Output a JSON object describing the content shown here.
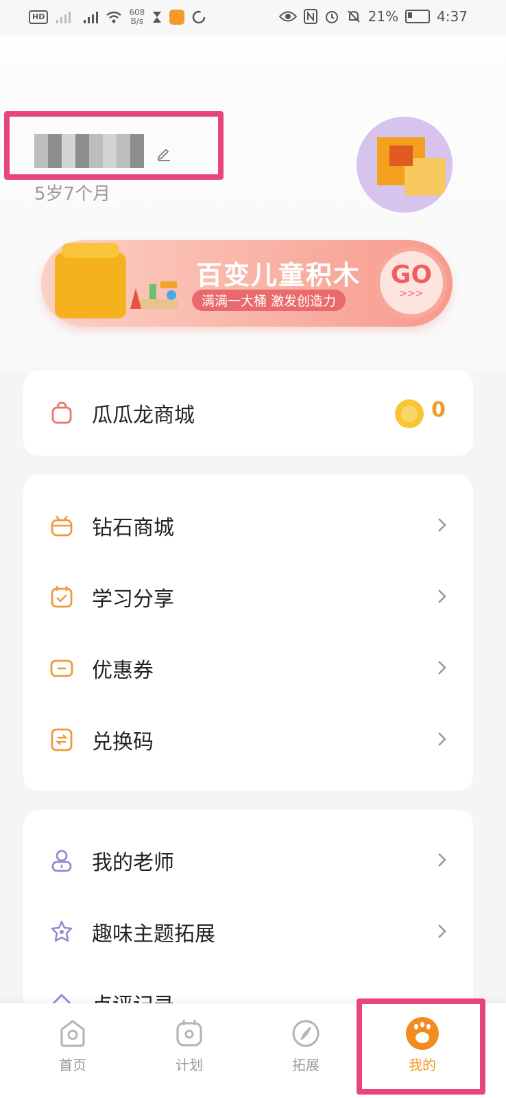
{
  "status_bar": {
    "hd": "HD",
    "net_speed_value": "608",
    "net_speed_unit": "B/s",
    "battery": "21%",
    "time": "4:37"
  },
  "profile": {
    "age": "5岁7个月"
  },
  "banner": {
    "title": "百变儿童积木",
    "subtitle": "满满一大桶 激发创造力",
    "button": "GO",
    "button_arrows": ">>>"
  },
  "shop_card": {
    "label": "瓜瓜龙商城",
    "coins": "0"
  },
  "menu_group_1": [
    {
      "label": "钻石商城",
      "icon": "basket-icon"
    },
    {
      "label": "学习分享",
      "icon": "calendar-check-icon"
    },
    {
      "label": "优惠券",
      "icon": "coupon-icon"
    },
    {
      "label": "兑换码",
      "icon": "exchange-code-icon"
    }
  ],
  "menu_group_2": [
    {
      "label": "我的老师",
      "icon": "teacher-icon"
    },
    {
      "label": "趣味主题拓展",
      "icon": "flower-icon"
    },
    {
      "label": "点评记录",
      "icon": "review-icon"
    }
  ],
  "bottom_nav": [
    {
      "label": "首页",
      "icon": "home-icon",
      "active": false
    },
    {
      "label": "计划",
      "icon": "plan-icon",
      "active": false
    },
    {
      "label": "拓展",
      "icon": "compass-icon",
      "active": false
    },
    {
      "label": "我的",
      "icon": "paw-icon",
      "active": true
    }
  ],
  "colors": {
    "accent": "#f29b24",
    "highlight_box": "#e8457e",
    "banner_pink": "#f79a8d"
  }
}
